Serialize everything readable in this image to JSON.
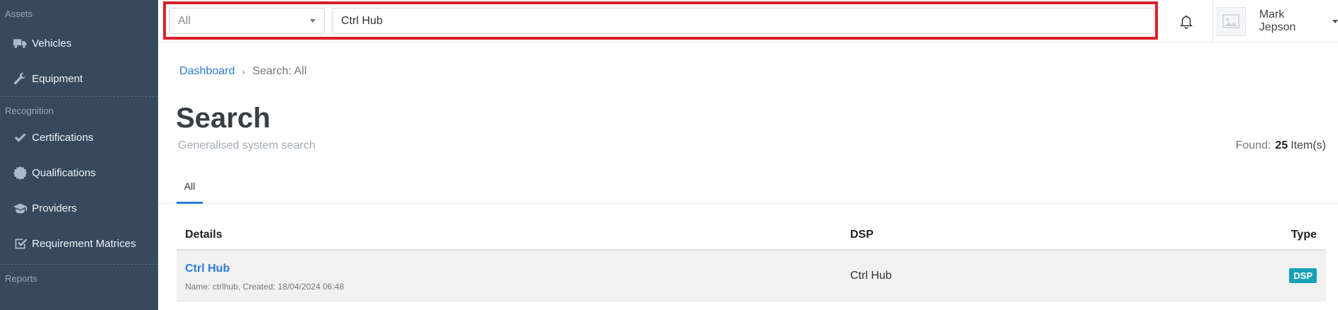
{
  "sidebar": {
    "sections": [
      {
        "label": "Assets"
      },
      {
        "label": "Recognition"
      },
      {
        "label": "Reports"
      }
    ],
    "items": [
      {
        "label": "Vehicles",
        "icon": "truck-icon"
      },
      {
        "label": "Equipment",
        "icon": "wrench-icon"
      },
      {
        "label": "Certifications",
        "icon": "check-icon"
      },
      {
        "label": "Qualifications",
        "icon": "certificate-icon"
      },
      {
        "label": "Providers",
        "icon": "graduation-cap-icon"
      },
      {
        "label": "Requirement Matrices",
        "icon": "checkbox-icon"
      }
    ]
  },
  "topbar": {
    "scope_value": "All",
    "search_value": "Ctrl Hub",
    "highlight_color": "#d9202a",
    "user_name": "Mark Jepson"
  },
  "breadcrumb": {
    "link": "Dashboard",
    "current": "Search: All"
  },
  "page": {
    "title": "Search",
    "subtitle": "Generalised system search",
    "found_label": "Found:",
    "found_count": "25",
    "found_unit": "Item(s)"
  },
  "tabs": [
    {
      "label": "All",
      "active": true
    }
  ],
  "table": {
    "columns": [
      "Details",
      "DSP",
      "Type"
    ],
    "rows": [
      {
        "title": "Ctrl Hub",
        "meta": "Name: ctrlhub, Created: 18/04/2024 06:48",
        "dsp": "Ctrl Hub",
        "type": "DSP"
      }
    ]
  },
  "colors": {
    "sidebar_bg": "#37495c",
    "accent": "#2f7bd9",
    "badge": "#17a2b8"
  }
}
